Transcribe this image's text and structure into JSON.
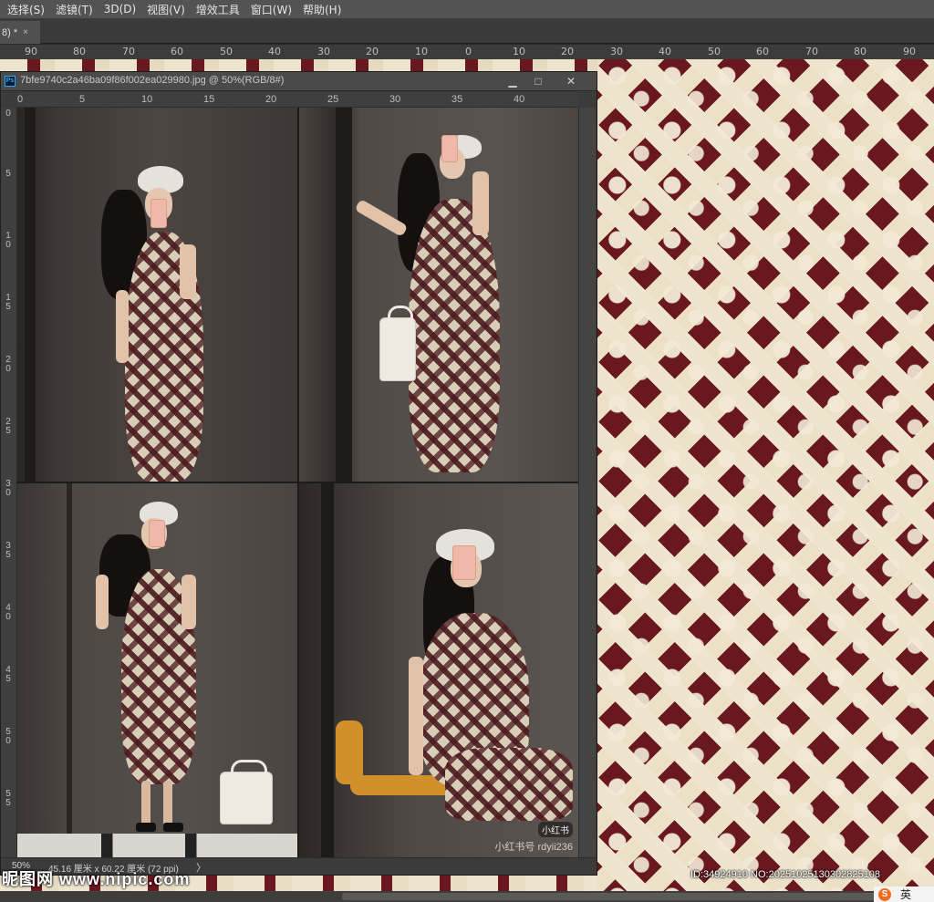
{
  "menu": [
    "选择(S)",
    "滤镜(T)",
    "3D(D)",
    "视图(V)",
    "增效工具",
    "窗口(W)",
    "帮助(H)"
  ],
  "doc_tab": {
    "label": "8) *",
    "close": "×"
  },
  "main_ruler": [
    "90",
    "80",
    "70",
    "60",
    "50",
    "40",
    "30",
    "20",
    "10",
    "0",
    "10",
    "20",
    "30",
    "40",
    "50",
    "60",
    "70",
    "80",
    "90"
  ],
  "doc_window": {
    "title": "7bfe9740c2a46ba09f86f002ea029980.jpg @ 50%(RGB/8#)",
    "buttons": {
      "minimize": "▁",
      "maximize": "□",
      "close": "✕"
    },
    "h_ruler": [
      "0",
      "5",
      "10",
      "15",
      "20",
      "25",
      "30",
      "35",
      "40"
    ],
    "v_ruler": [
      "0",
      "5",
      "1 0",
      "1 5",
      "2 0",
      "2 5",
      "3 0",
      "3 5",
      "4 0",
      "4 5",
      "5 0",
      "5 5"
    ],
    "status": {
      "zoom": "50%",
      "dimensions": "45.16 厘米 x 60.22 厘米 (72 ppi)",
      "arrow": "〉"
    },
    "photo_watermark": {
      "badge": "小红书",
      "text": "小红书号 rdyii236"
    }
  },
  "watermarks": {
    "nipic": "昵图网 www.nipic.com",
    "id": "ID:34924910 NO:20251025130302825108"
  },
  "ime": {
    "icon": "S",
    "lang": "英"
  }
}
